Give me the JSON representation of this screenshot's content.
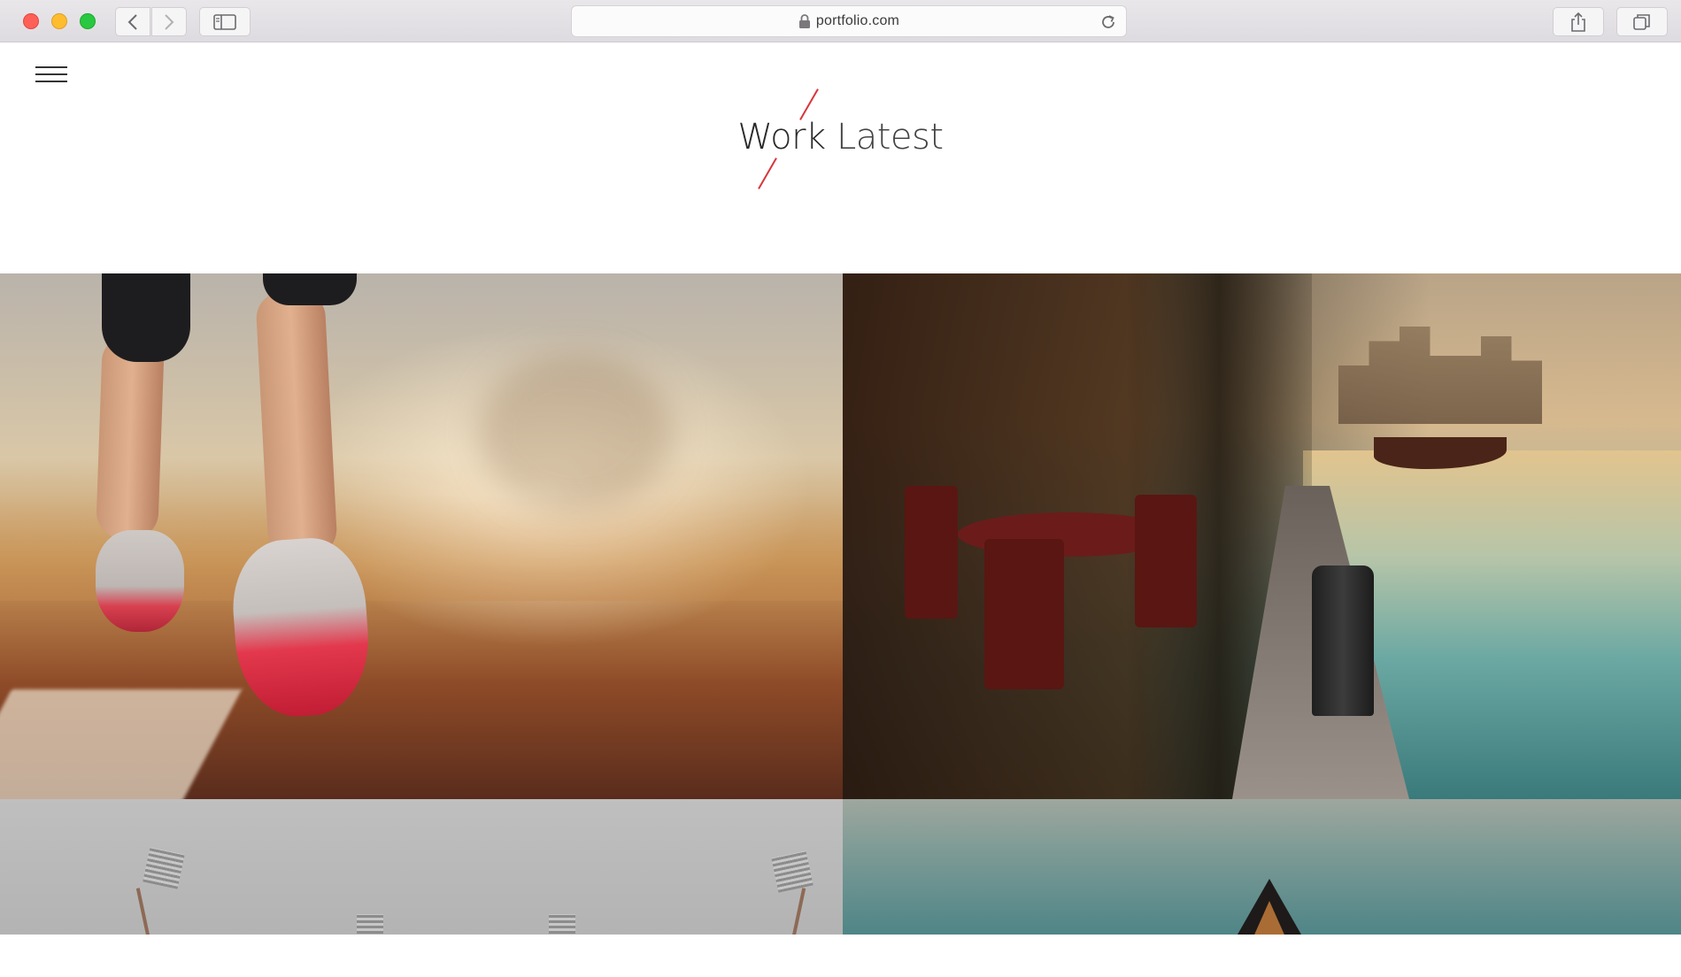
{
  "browser": {
    "url": "portfolio.com",
    "buttons": {
      "back": "chevron-left",
      "forward": "chevron-right",
      "sidebar": "sidebar",
      "reload": "reload",
      "share": "share",
      "tabs": "tabs"
    }
  },
  "header": {
    "title_word_1": "Work",
    "title_word_2": "Latest",
    "accent_color": "#d8353b"
  },
  "portfolio": {
    "items": [
      {
        "subject": "runner"
      },
      {
        "subject": "waterfront restaurant"
      },
      {
        "subject": "stadium floodlights"
      },
      {
        "subject": "pyramid"
      }
    ]
  }
}
